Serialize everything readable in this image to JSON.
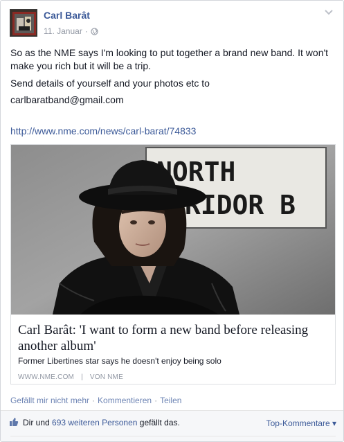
{
  "post": {
    "author": "Carl Barât",
    "date": "11. Januar",
    "date_separator": "·",
    "privacy_icon": "globe-icon",
    "options_icon": "chevron-down-icon",
    "message_lines": [
      "So as the NME says I'm looking to put together a brand new band. It won't make you rich but it will be a trip.",
      "Send details of yourself and your photos etc to",
      "carlbaratband@gmail.com"
    ],
    "link": "http://www.nme.com/news/carl-barat/74833"
  },
  "preview": {
    "image_sign_line1": "NORTH",
    "image_sign_line2": "RRIDOR B",
    "title": "Carl Barât: 'I want to form a new band before releasing another album'",
    "description": "Former Libertines star says he doesn't enjoy being solo",
    "source_domain": "WWW.NME.COM",
    "source_separator": "|",
    "source_by": "VON NME"
  },
  "actions": {
    "unlike": "Gefällt mir nicht mehr",
    "comment": "Kommentieren",
    "share": "Teilen",
    "separator": "·"
  },
  "likes": {
    "prefix": "Dir und",
    "others": "693 weiteren Personen",
    "suffix": "gefällt das.",
    "top_comments": "Top-Kommentare ▾",
    "icon": "thumbs-up-icon"
  },
  "colors": {
    "link_blue": "#3b5998",
    "action_blue": "#6d84b4",
    "muted_gray": "#9197a3"
  }
}
